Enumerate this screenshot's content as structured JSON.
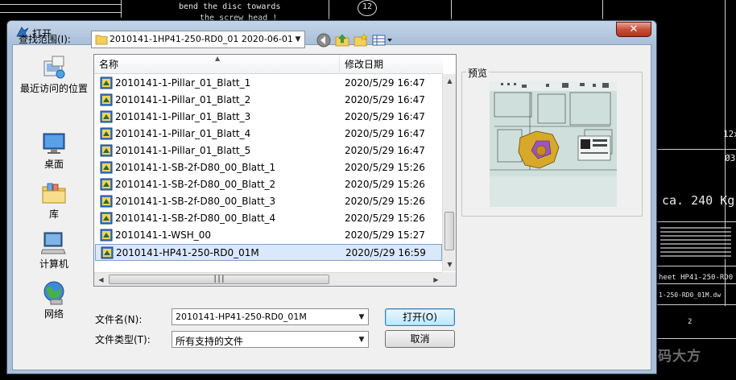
{
  "background": {
    "cad_note_line1": "bend the disc towards",
    "cad_note_line2": "the screw head !",
    "cad_balloon": "12",
    "cad_weight": "ca. 240 Kg",
    "cad_dim1": "12x",
    "cad_dim2": "Ø3",
    "cad_sheet": "heet HP41-250-RD0",
    "cad_file": "1-250-RD0_01M.dw",
    "cad_num": "2",
    "watermark": "咖啡社区 | CAXA数码大方"
  },
  "dialog": {
    "title": "打开",
    "close_label": "✕"
  },
  "lookin": {
    "label": "查找范围(I):",
    "value": "2010141-1HP41-250-RD0_01 2020-06-01"
  },
  "places": [
    {
      "label": "最近访问的位置"
    },
    {
      "label": "桌面"
    },
    {
      "label": "库"
    },
    {
      "label": "计算机"
    },
    {
      "label": "网络"
    }
  ],
  "filelist": {
    "col_name": "名称",
    "col_date": "修改日期",
    "rows": [
      {
        "name": "2010141-1-Pillar_01_Blatt_1",
        "date": "2020/5/29 16:47"
      },
      {
        "name": "2010141-1-Pillar_01_Blatt_2",
        "date": "2020/5/29 16:47"
      },
      {
        "name": "2010141-1-Pillar_01_Blatt_3",
        "date": "2020/5/29 16:47"
      },
      {
        "name": "2010141-1-Pillar_01_Blatt_4",
        "date": "2020/5/29 16:47"
      },
      {
        "name": "2010141-1-Pillar_01_Blatt_5",
        "date": "2020/5/29 16:47"
      },
      {
        "name": "2010141-1-SB-2f-D80_00_Blatt_1",
        "date": "2020/5/29 15:26"
      },
      {
        "name": "2010141-1-SB-2f-D80_00_Blatt_2",
        "date": "2020/5/29 15:26"
      },
      {
        "name": "2010141-1-SB-2f-D80_00_Blatt_3",
        "date": "2020/5/29 15:26"
      },
      {
        "name": "2010141-1-SB-2f-D80_00_Blatt_4",
        "date": "2020/5/29 15:26"
      },
      {
        "name": "2010141-1-WSH_00",
        "date": "2020/5/29 15:27"
      },
      {
        "name": "2010141-HP41-250-RD0_01M",
        "date": "2020/5/29 16:59",
        "selected": true
      }
    ]
  },
  "preview": {
    "label": "预览"
  },
  "bottom": {
    "filename_label": "文件名(N):",
    "filename_value": "2010141-HP41-250-RD0_01M",
    "filetype_label": "文件类型(T):",
    "filetype_value": "所有支持的文件",
    "open_label": "打开(O)",
    "cancel_label": "取消"
  },
  "colors": {
    "title_gradient": "#a8bfd9",
    "selection": "#d9e8fb",
    "close_button": "#c8503b"
  }
}
